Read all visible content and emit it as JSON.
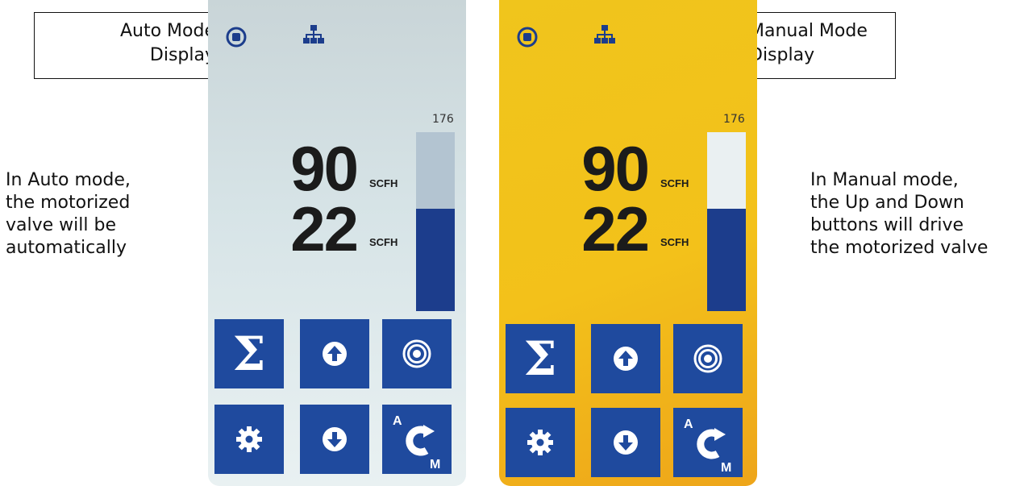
{
  "auto_display": {
    "callout_line1": "Auto Mode",
    "callout_line2": "Display",
    "note_lines": [
      "In Auto mode,",
      "the motorized",
      "valve will be",
      "automatically"
    ],
    "scale_max": "176",
    "flow_primary": "90",
    "flow_primary_unit": "SCFH",
    "flow_secondary": "22",
    "flow_secondary_unit": "SCFH",
    "bar_level_fraction": 0.57,
    "colors": {
      "background": "#d7e4e7",
      "button": "#1f4a9e",
      "bar_fill": "#1c3d8c",
      "bar_track": "#b3c4d1"
    }
  },
  "manual_display": {
    "callout_line1": "Manual Mode",
    "callout_line2": "Display",
    "note_lines": [
      "In Manual mode,",
      "the Up and Down",
      "buttons will drive",
      "the motorized valve"
    ],
    "scale_max": "176",
    "flow_primary": "90",
    "flow_primary_unit": "SCFH",
    "flow_secondary": "22",
    "flow_secondary_unit": "SCFH",
    "bar_level_fraction": 0.57,
    "colors": {
      "background": "#f3c11a",
      "button": "#1f4a9e",
      "bar_fill": "#1c3d8c",
      "bar_track": "#eaf0f2"
    }
  },
  "buttons": [
    {
      "name": "totalizer-button",
      "icon": "sigma-icon"
    },
    {
      "name": "up-button",
      "icon": "arrow-up-circle-icon"
    },
    {
      "name": "target-button",
      "icon": "concentric-circles-icon"
    },
    {
      "name": "settings-button",
      "icon": "gear-icon"
    },
    {
      "name": "down-button",
      "icon": "arrow-down-circle-icon"
    },
    {
      "name": "auto-manual-toggle-button",
      "icon": "auto-manual-icon",
      "label_top": "A",
      "label_bottom": "M"
    }
  ]
}
